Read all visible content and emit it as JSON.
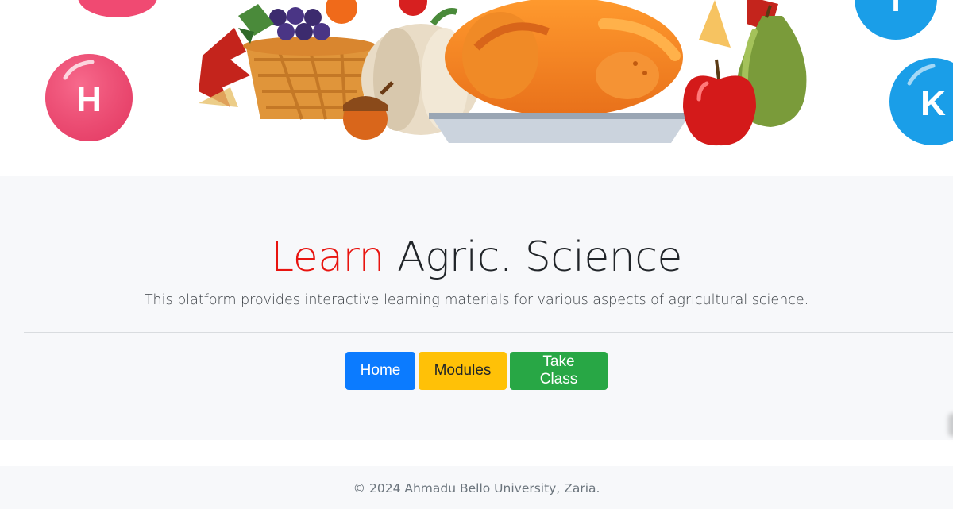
{
  "hero": {
    "bubble_letters": [
      "H",
      "I",
      "K"
    ],
    "colors": {
      "pink_bubble": "#f04a72",
      "blue_bubble": "#1a9ee8"
    }
  },
  "jumbotron": {
    "title_accent": "Learn",
    "title_rest": "Agric. Science",
    "lead": "This platform provides interactive learning materials for various aspects of agricultural science.",
    "buttons": {
      "home": "Home",
      "modules": "Modules",
      "take_class": "Take Class"
    },
    "colors": {
      "accent": "#e8140f",
      "home": "#0b7bff",
      "modules": "#ffc107",
      "take_class": "#28a745"
    }
  },
  "footer": {
    "text": "© 2024 Ahmadu Bello University, Zaria."
  }
}
